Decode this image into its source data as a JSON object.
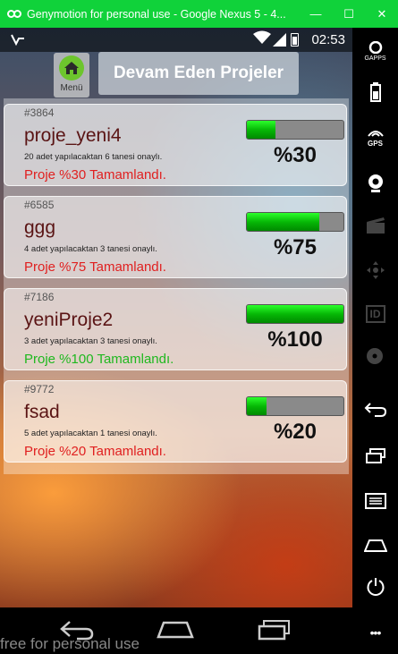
{
  "window": {
    "title": "Genymotion for personal use - Google Nexus 5 - 4...",
    "minimize_glyph": "—",
    "maximize_glyph": "☐",
    "close_glyph": "✕"
  },
  "statusbar": {
    "time": "02:53"
  },
  "header": {
    "menu_label": "Menü",
    "title": "Devam Eden Projeler"
  },
  "projects": [
    {
      "id": "#3864",
      "name": "proje_yeni4",
      "subtitle": "20 adet yapılacaktan 6 tanesi onaylı.",
      "status": "Proje %30 Tamamlandı.",
      "percent_label": "%30",
      "progress": 30,
      "status_color": "#e02020"
    },
    {
      "id": "#6585",
      "name": "ggg",
      "subtitle": "4 adet yapılacaktan 3 tanesi onaylı.",
      "status": "Proje %75 Tamamlandı.",
      "percent_label": "%75",
      "progress": 75,
      "status_color": "#e02020"
    },
    {
      "id": "#7186",
      "name": "yeniProje2",
      "subtitle": "3 adet yapılacaktan 3 tanesi onaylı.",
      "status": "Proje %100 Tamamlandı.",
      "percent_label": "%100",
      "progress": 100,
      "status_color": "#1fb81f"
    },
    {
      "id": "#9772",
      "name": "fsad",
      "subtitle": "5 adet yapılacaktan 1 tanesi onaylı.",
      "status": "Proje %20 Tamamlandı.",
      "percent_label": "%20",
      "progress": 20,
      "status_color": "#e02020"
    }
  ],
  "sidebar": {
    "gapps_label": "GAPPS",
    "gps_label": "GPS",
    "id_label": "ID",
    "more_glyph": "•••"
  },
  "watermark": "free for personal use",
  "icons": [
    "genymotion-logo-icon",
    "notification-icon",
    "wifi-icon",
    "signal-icon",
    "battery-icon",
    "home-icon",
    "back-icon",
    "recents-icon",
    "gapps-icon",
    "gps-icon",
    "webcam-icon",
    "clapper-icon",
    "dpad-icon",
    "id-icon",
    "disk-icon",
    "rotate-icon",
    "menu-icon",
    "power-icon"
  ]
}
